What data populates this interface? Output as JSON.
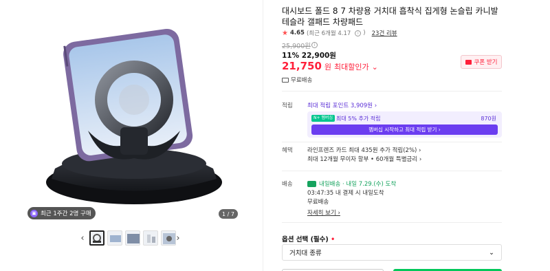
{
  "gallery": {
    "recent_purchase": "최근 1주간 2명 구매",
    "counter": "1 / 7",
    "prev_arrow": "‹",
    "next_arrow": "›",
    "thumbnails": 5
  },
  "product": {
    "title": "대시보드 폴드 8 7 차량용 거치대 흡착식 집게형 논슬립 카니발 테슬라 갤패드 차량패드",
    "rating": {
      "score": "4.65",
      "recent": "(최근 6개월 4.17",
      "recent_close": ")",
      "reviews": "23건 리뷰"
    },
    "original_price": "25,900원",
    "discount_line": "11% 22,900원",
    "final_price": "21,750",
    "final_unit": "원",
    "final_label": "최대할인가",
    "coupon": "쿠폰 받기",
    "free_shipping": "무료배송"
  },
  "points": {
    "label": "적립",
    "max_points": "최대 적립 포인트 3,909원 ›",
    "tag": "N+ 멤버십",
    "extra": "최대 5% 추가 적립",
    "amount": "870원",
    "join_button": "멤버십 시작하고 최대 적립 받기 ›"
  },
  "benefit": {
    "label": "혜택",
    "line1": "라인프렌즈 카드 최대 435원 추가 적립(2%) ›",
    "line2": "최대 12개월 무이자 할부 • 60개월 특별금리 ›"
  },
  "delivery": {
    "label": "배송",
    "badge": "내일배송 · 내일 7.29.(수) 도착",
    "cutoff": "03:47:35  내 결제 시 내일도착",
    "fee": "무료배송",
    "detail": "자세히 보기 ›"
  },
  "option": {
    "label": "옵션 선택 (필수)",
    "required_mark": "•",
    "selected": "거치대 종류",
    "chevron": "⌄"
  },
  "colors": {
    "accent_red": "#ff1f3a",
    "naver_purple": "#6b3df0",
    "green": "#15a35e"
  }
}
